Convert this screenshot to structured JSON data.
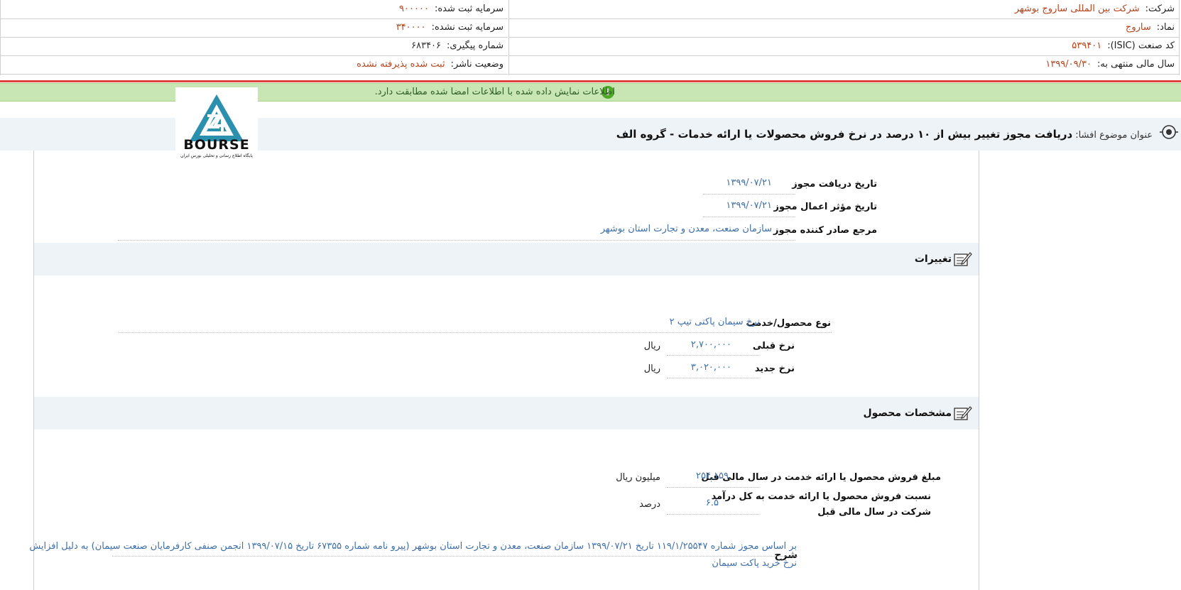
{
  "header": {
    "company_label": "شرکت:",
    "company_value": "شرکت بین المللی ساروج بوشهر",
    "symbol_label": "نماد:",
    "symbol_value": "ساروج",
    "isic_label": "کد صنعت (ISIC):",
    "isic_value": "۵۳۹۴۰۱",
    "fiscal_label": "سال مالی منتهی به:",
    "fiscal_value": "۱۳۹۹/۰۹/۳۰",
    "reg_capital_label": "سرمایه ثبت شده:",
    "reg_capital_value": "۹۰۰۰۰۰",
    "unreg_capital_label": "سرمایه ثبت نشده:",
    "unreg_capital_value": "۳۴۰۰۰۰",
    "tracking_label": "شماره پیگیری:",
    "tracking_value": "۶۸۳۴۰۶",
    "status_label": "وضعیت ناشر:",
    "status_value": "ثبت شده پذیرفته نشده"
  },
  "notice": {
    "message": "اطلاعات نمایش داده شده با اطلاعات امضا شده مطابقت دارد.",
    "icon": "info-icon",
    "color": "#4fa82a"
  },
  "subject": {
    "label": "عنوان موضوع افشا:",
    "value": "دریافت مجوز تغییر بیش از ۱۰ درصد در نرخ فروش محصولات یا ارائه خدمات - گروه الف"
  },
  "logo": {
    "word": "BOURSE",
    "tagline": "پایگاه اطلاع رسانی و تحلیلی بورس ایران",
    "icon": "bourse24-logo"
  },
  "permit": {
    "receive_date_label": "تاریخ دریافت مجوز",
    "receive_date_value": "۱۳۹۹/۰۷/۲۱",
    "effective_date_label": "تاریخ مؤثر اعمال مجوز",
    "effective_date_value": "۱۳۹۹/۰۷/۲۱",
    "issuer_label": "مرجع صادر کننده مجوز",
    "issuer_value": "سازمان صنعت، معدن و تجارت استان بوشهر"
  },
  "changes": {
    "title": "تغییرات",
    "product_label": "نوع محصول/خدمت",
    "product_value": "نرخ سیمان پاکتی تیپ ۲",
    "prev_price_label": "نرخ قبلی",
    "prev_price_value": "۲,۷۰۰,۰۰۰",
    "prev_price_unit": "ریال",
    "new_price_label": "نرخ جدید",
    "new_price_value": "۳,۰۲۰,۰۰۰",
    "new_price_unit": "ریال"
  },
  "product_specs": {
    "title": "مشخصات محصول",
    "sales_label": "مبلغ فروش محصول یا ارائه خدمت در سال مالی قبل",
    "sales_value": "۲۵۴,۱۵۹",
    "sales_unit": "میلیون ریال",
    "ratio_label_1": "نسبت فروش محصول یا ارائه خدمت به کل درآمد",
    "ratio_label_2": "شرکت در سال مالی قبل",
    "ratio_value": "۶.۵",
    "ratio_unit": "درصد",
    "desc_label": "شرح",
    "desc_line1": "بر اساس مجوز شماره ۱۱۹/۱/۲۵۵۴۷ تاریخ ۱۳۹۹/۰۷/۲۱ سازمان صنعت، معدن و تجارت استان بوشهر (پیرو نامه شماره ۶۷۳۵۵ تاریخ ۱۳۹۹/۰۷/۱۵ انجمن صنفی کارفرمایان صنعت سیمان) به دلیل افزایش",
    "desc_line2": "نرخ خرید پاکت سیمان"
  }
}
